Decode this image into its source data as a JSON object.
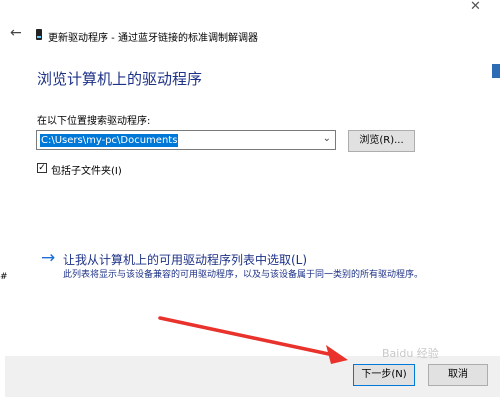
{
  "window": {
    "title": "更新驱动程序 - 通过蓝牙链接的标准调制解调器",
    "back_glyph": "←",
    "close_glyph": "✕"
  },
  "main": {
    "heading": "浏览计算机上的驱动程序",
    "search_label": "在以下位置搜索驱动程序:",
    "path_value": "C:\\Users\\my-pc\\Documents",
    "browse_label": "浏览(R)...",
    "include_subfolders_label": "包括子文件夹(I)",
    "include_subfolders_checked": true,
    "pick_link_arrow": "→",
    "pick_link_label": "让我从计算机上的可用驱动程序列表中选取(L)",
    "pick_link_description": "此列表将显示与该设备兼容的可用驱动程序，以及与该设备属于同一类别的所有驱动程序。"
  },
  "footer": {
    "next_label": "下一步(N)",
    "cancel_label": "取消"
  },
  "watermark": {
    "text": "Baidu 经验"
  },
  "colors": {
    "heading": "#1e3287",
    "selection": "#0078d7",
    "footer_bg": "#f0f0f0",
    "annotation_arrow": "#e8322b"
  }
}
